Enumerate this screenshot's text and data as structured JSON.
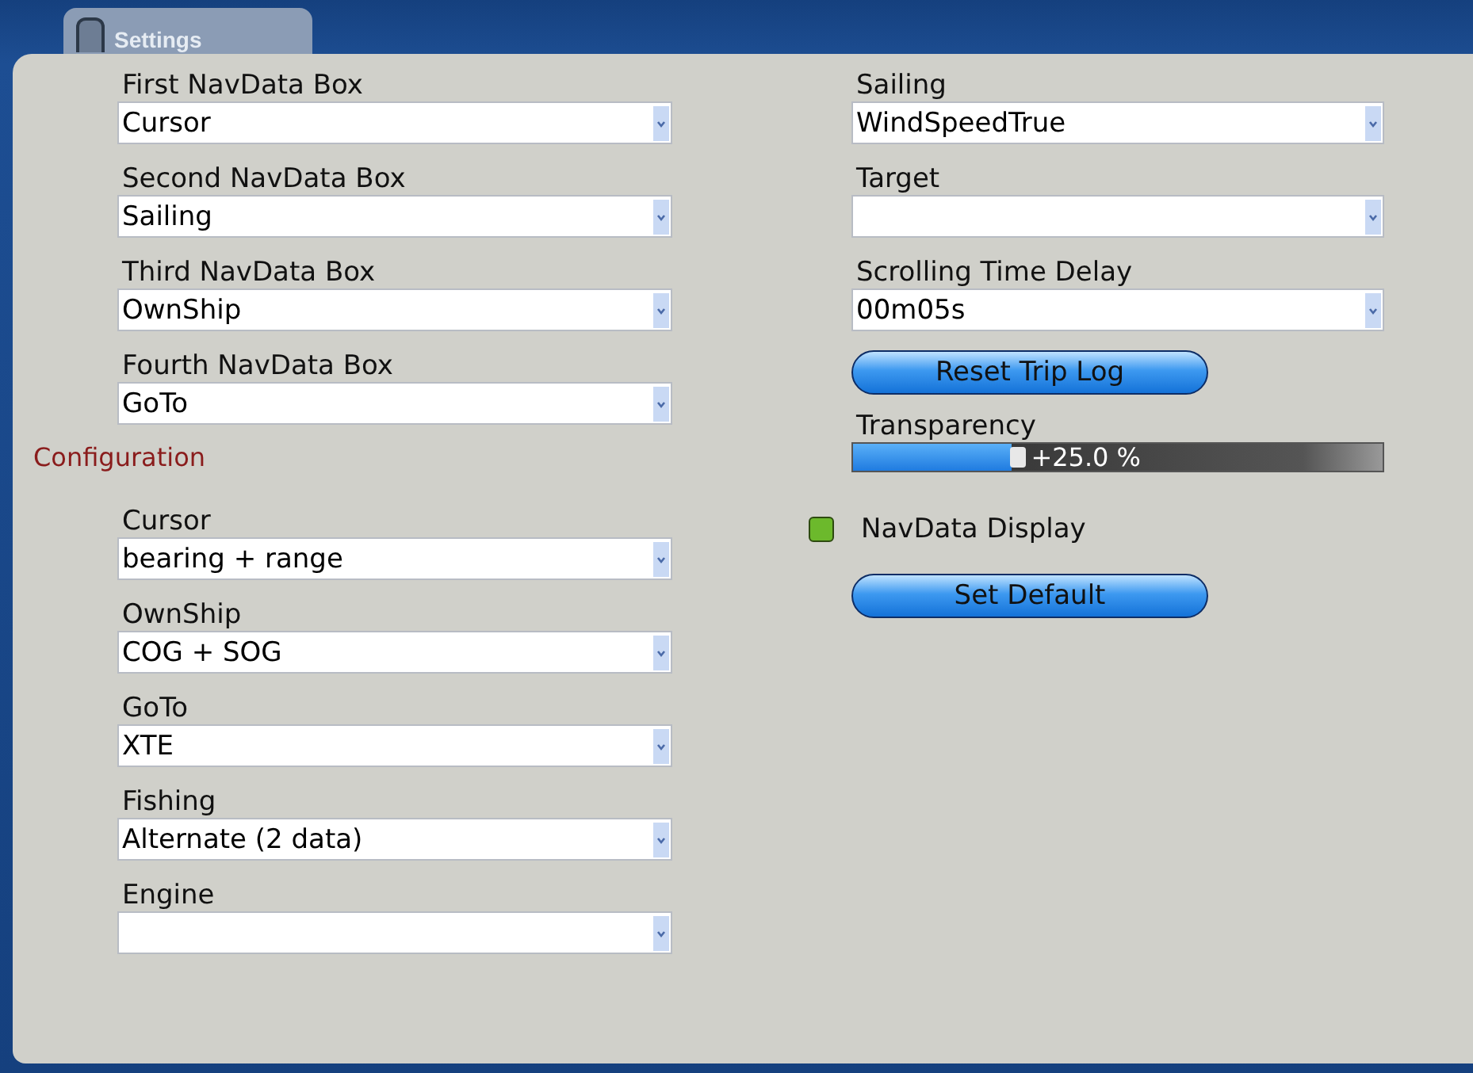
{
  "tab": {
    "label": "Settings"
  },
  "navdata_boxes": [
    {
      "label": "First NavData Box",
      "value": "Cursor"
    },
    {
      "label": "Second NavData Box",
      "value": "Sailing"
    },
    {
      "label": "Third NavData Box",
      "value": "OwnShip"
    },
    {
      "label": "Fourth NavData Box",
      "value": "GoTo"
    }
  ],
  "configuration": {
    "heading": "Configuration",
    "fields": [
      {
        "label": "Cursor",
        "value": "bearing + range"
      },
      {
        "label": "OwnShip",
        "value": "COG + SOG"
      },
      {
        "label": "GoTo",
        "value": "XTE"
      },
      {
        "label": "Fishing",
        "value": "Alternate (2 data)"
      },
      {
        "label": "Engine"
      }
    ]
  },
  "right_fields": [
    {
      "label": "Sailing",
      "value": "WindSpeedTrue"
    },
    {
      "label": "Target"
    },
    {
      "label": "Scrolling Time Delay",
      "value": "00m05s"
    }
  ],
  "reset_button": "Reset Trip Log",
  "transparency": {
    "label": "Transparency",
    "level": 0.3,
    "reading": "+25.0 %"
  },
  "navdata_display": {
    "label": "NavData Display",
    "on": true
  },
  "default_button": "Set Default"
}
